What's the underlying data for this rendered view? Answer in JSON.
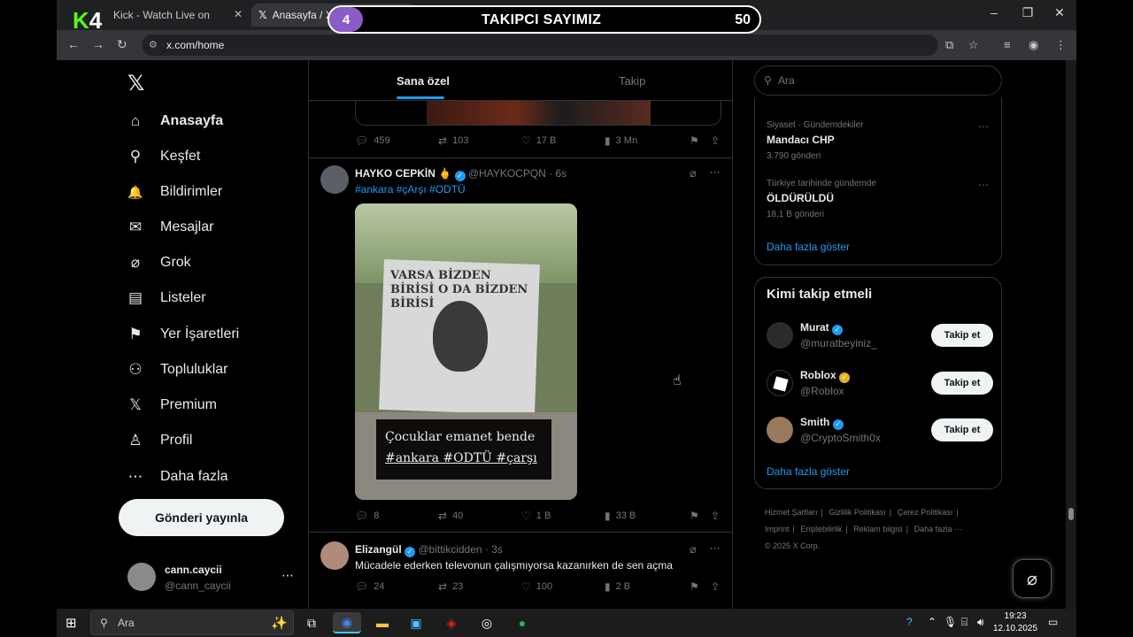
{
  "browser": {
    "tabs": [
      {
        "title": "Kick - Watch Live on"
      },
      {
        "title": "Anasayfa / X"
      }
    ],
    "new_tab": "+",
    "url": "x.com/home",
    "window_controls": {
      "minimize": "–",
      "maximize": "❐",
      "close": "✕"
    }
  },
  "overlay": {
    "badge": "4",
    "title": "TAKIPCI SAYIMIZ",
    "count": "50",
    "logo_k": "K",
    "logo_num": "4"
  },
  "sidebar": {
    "logo": "𝕏",
    "items": [
      {
        "label": "Anasayfa",
        "icon": "⌂"
      },
      {
        "label": "Keşfet",
        "icon": "⚲"
      },
      {
        "label": "Bildirimler",
        "icon": "🔔"
      },
      {
        "label": "Mesajlar",
        "icon": "✉"
      },
      {
        "label": "Grok",
        "icon": "⌀"
      },
      {
        "label": "Listeler",
        "icon": "▤"
      },
      {
        "label": "Yer İşaretleri",
        "icon": "⚑"
      },
      {
        "label": "Topluluklar",
        "icon": "⚇"
      },
      {
        "label": "Premium",
        "icon": "𝕏"
      },
      {
        "label": "Profil",
        "icon": "♙"
      },
      {
        "label": "Daha fazla",
        "icon": "⋯"
      }
    ],
    "post_button": "Gönderi yayınla",
    "me": {
      "name": "cann.caycii",
      "handle": "@cann_caycii",
      "more": "⋯"
    }
  },
  "timeline": {
    "tabs": [
      "Sana özel",
      "Takip"
    ],
    "posts": [
      {
        "replies": "459",
        "reposts": "103",
        "likes": "17 B",
        "views": "3 Mn"
      },
      {
        "name": "HAYKO CEPKİN 🖕",
        "handle": "@HAYKOCPQN · 6s",
        "text": "#ankara #çArşı #ODTÜ",
        "media_flag_text": "VARSA BİZDEN BİRİSİ O DA BİZDEN BİRİSİ",
        "media_caption_1": "Çocuklar emanet bende",
        "media_caption_2": "#ankara #ODTÜ #çarşı",
        "replies": "8",
        "reposts": "40",
        "likes": "1 B",
        "views": "33 B"
      },
      {
        "name": "Elizangül",
        "handle": "@bittikcidden · 3s",
        "text": "Mücadele ederken televonun çalışmıyorsa kazanırken de sen açma",
        "replies": "24",
        "reposts": "23",
        "likes": "100",
        "views": "2 B"
      }
    ]
  },
  "right": {
    "search_placeholder": "Ara",
    "trends": [
      {
        "category": "Siyaset · Gündemdekiler",
        "name": "Mandacı CHP",
        "posts": "3.790 gönderi"
      },
      {
        "category": "Türkiye tarihinde gündemde",
        "name": "ÖLDÜRÜLDÜ",
        "posts": "18,1 B gönderi"
      }
    ],
    "trends_more": "Daha fazla göster",
    "who_to_follow_title": "Kimi takip etmeli",
    "who_to_follow": [
      {
        "name": "Murat",
        "handle": "@muratbeyiniz_",
        "button": "Takip et"
      },
      {
        "name": "Roblox",
        "handle": "@Roblox",
        "button": "Takip et"
      },
      {
        "name": "Smith",
        "handle": "@CryptoSmith0x",
        "button": "Takip et"
      }
    ],
    "wtf_more": "Daha fazla göster",
    "footer": [
      "Hizmet Şartları",
      "|",
      "Gizlilik Politikası",
      "|",
      "Çerez Politikası",
      "|",
      "Imprint",
      "|",
      "Erişilebilirlik",
      "|",
      "Reklam bilgisi",
      "|",
      "Daha fazla ···",
      "© 2025 X Corp."
    ]
  },
  "taskbar": {
    "search": "Ara",
    "time": "19:23",
    "date": "12.10.2025"
  }
}
